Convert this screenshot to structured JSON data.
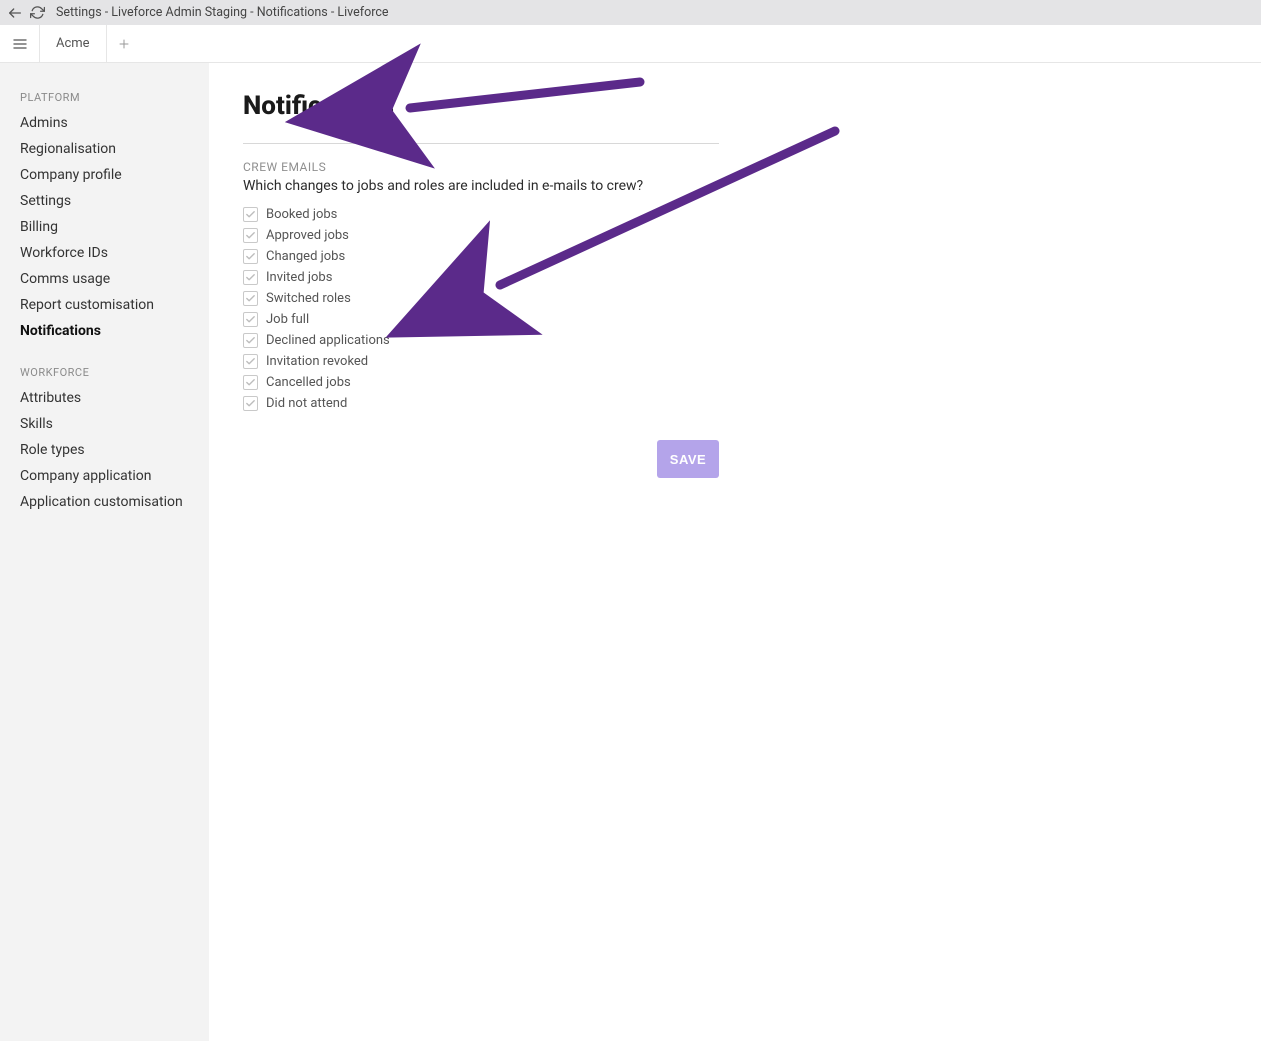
{
  "browser": {
    "title": "Settings - Liveforce Admin Staging - Notifications - Liveforce"
  },
  "tabbar": {
    "workspace_tab": "Acme"
  },
  "sidebar": {
    "groups": [
      {
        "label": "PLATFORM",
        "items": [
          {
            "label": "Admins",
            "active": false
          },
          {
            "label": "Regionalisation",
            "active": false
          },
          {
            "label": "Company profile",
            "active": false
          },
          {
            "label": "Settings",
            "active": false
          },
          {
            "label": "Billing",
            "active": false
          },
          {
            "label": "Workforce IDs",
            "active": false
          },
          {
            "label": "Comms usage",
            "active": false
          },
          {
            "label": "Report customisation",
            "active": false
          },
          {
            "label": "Notifications",
            "active": true
          }
        ]
      },
      {
        "label": "WORKFORCE",
        "items": [
          {
            "label": "Attributes",
            "active": false
          },
          {
            "label": "Skills",
            "active": false
          },
          {
            "label": "Role types",
            "active": false
          },
          {
            "label": "Company application",
            "active": false
          },
          {
            "label": "Application customisation",
            "active": false
          }
        ]
      }
    ]
  },
  "page": {
    "title": "Notifications",
    "section_label": "CREW EMAILS",
    "section_desc": "Which changes to jobs and roles are included in e-mails to crew?",
    "checkboxes": [
      {
        "label": "Booked jobs",
        "checked": true
      },
      {
        "label": "Approved jobs",
        "checked": true
      },
      {
        "label": "Changed jobs",
        "checked": true
      },
      {
        "label": "Invited jobs",
        "checked": true
      },
      {
        "label": "Switched roles",
        "checked": true
      },
      {
        "label": "Job full",
        "checked": true
      },
      {
        "label": "Declined applications",
        "checked": true
      },
      {
        "label": "Invitation revoked",
        "checked": true
      },
      {
        "label": "Cancelled jobs",
        "checked": true
      },
      {
        "label": "Did not attend",
        "checked": true
      }
    ],
    "save_label": "SAVE"
  },
  "annotations": {
    "arrow_color": "#5b2a8a"
  }
}
